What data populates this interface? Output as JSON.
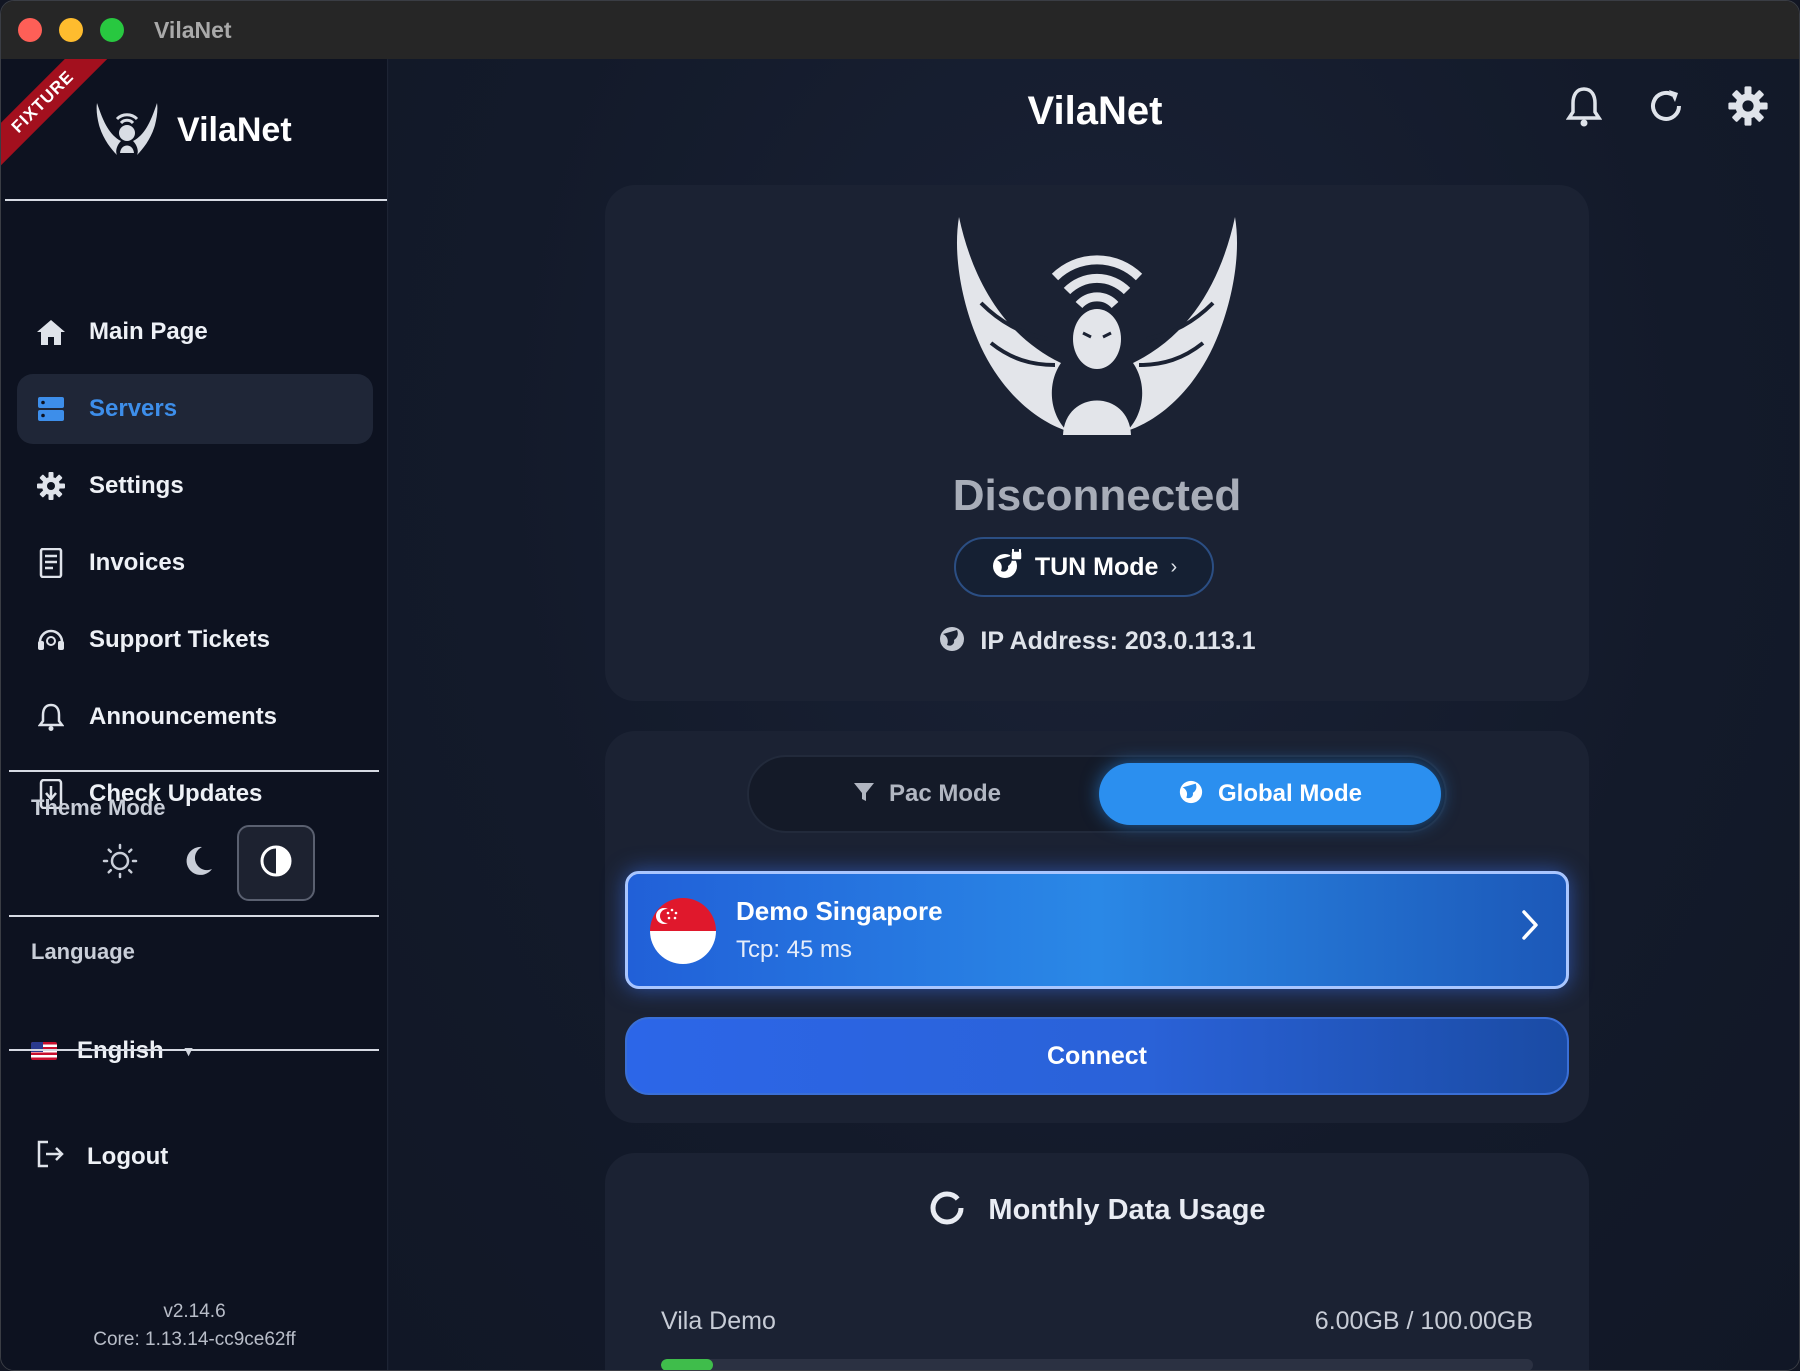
{
  "window": {
    "title": "VilaNet"
  },
  "sidebar": {
    "ribbon": "FIXTURE",
    "brand": "VilaNet",
    "nav": [
      {
        "label": "Main Page",
        "icon": "home-icon",
        "active": false
      },
      {
        "label": "Servers",
        "icon": "servers-icon",
        "active": true
      },
      {
        "label": "Settings",
        "icon": "gear-icon",
        "active": false
      },
      {
        "label": "Invoices",
        "icon": "invoice-icon",
        "active": false
      },
      {
        "label": "Support Tickets",
        "icon": "headset-icon",
        "active": false
      },
      {
        "label": "Announcements",
        "icon": "bell-icon",
        "active": false
      },
      {
        "label": "Check Updates",
        "icon": "download-icon",
        "active": false
      }
    ],
    "theme": {
      "label": "Theme Mode",
      "options": [
        "light",
        "dark",
        "auto"
      ],
      "selected": "auto"
    },
    "language": {
      "label": "Language",
      "value": "English"
    },
    "logout": "Logout",
    "version": "v2.14.6",
    "core": "Core: 1.13.14-cc9ce62ff"
  },
  "main": {
    "title": "VilaNet",
    "status": "Disconnected",
    "tun_mode": "TUN Mode",
    "ip": "IP Address: 203.0.113.1",
    "modes": {
      "pac": "Pac Mode",
      "global": "Global Mode",
      "selected": "global"
    },
    "server": {
      "name": "Demo Singapore",
      "latency": "Tcp: 45 ms"
    },
    "connect": "Connect",
    "usage": {
      "title": "Monthly Data Usage",
      "plan": "Vila Demo",
      "quota": "6.00GB / 100.00GB",
      "fraction": 0.06
    }
  },
  "colors": {
    "accent": "#2b8fef",
    "active_nav": "#3d8eea",
    "progress": "#3fbd4b"
  }
}
